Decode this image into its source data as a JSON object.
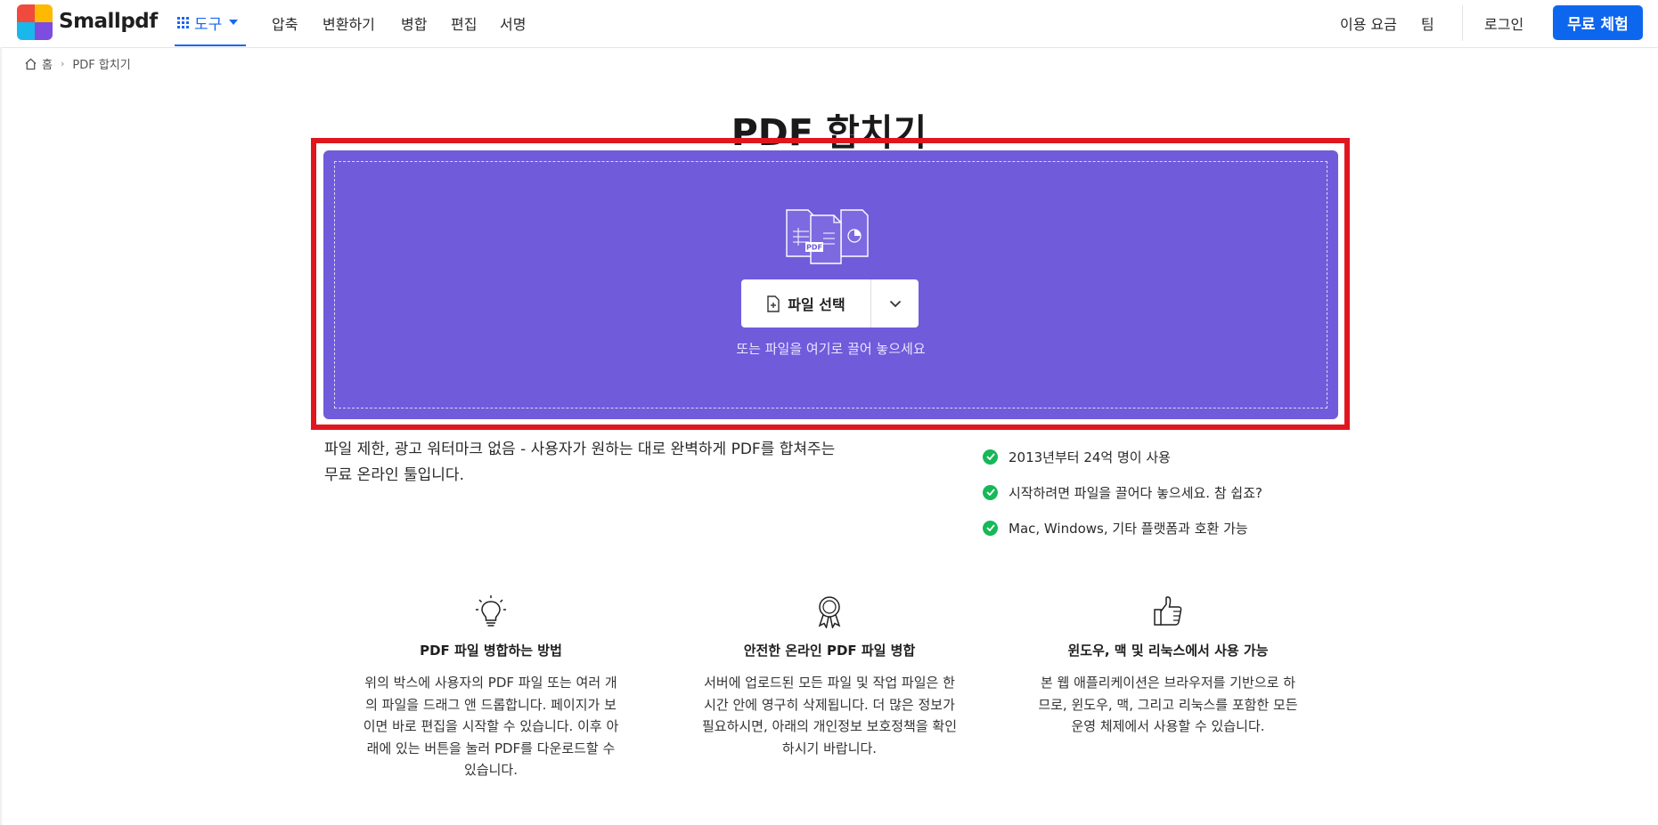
{
  "header": {
    "brand": "Smallpdf",
    "logo_colors": [
      "#f04a3e",
      "#ffb900",
      "#1ab7ea",
      "#22c55e"
    ],
    "tools_label": "도구",
    "nav": [
      "압축",
      "변환하기",
      "병합",
      "편집",
      "서명"
    ],
    "pricing_label": "이용 요금",
    "team_label": "팀",
    "login_label": "로그인",
    "cta_label": "무료 체험"
  },
  "breadcrumb": {
    "home": "홈",
    "current": "PDF 합치기"
  },
  "page_title": "PDF 합치기",
  "dropzone": {
    "bg_color": "#705bdb",
    "file_badge": "PDF",
    "choose_label": "파일 선택",
    "hint": "또는 파일을 여기로 끌어 놓으세요"
  },
  "description": {
    "line1": "파일 제한, 광고 워터마크 없음 - 사용자가 원하는 대로 완벽하게 PDF를 합쳐주는",
    "line2": "무료 온라인 툴입니다."
  },
  "checks": [
    "2013년부터 24억 명이 사용",
    "시작하려면 파일을 끌어다 놓으세요. 참 쉽죠?",
    "Mac, Windows, 기타 플랫폼과 호환 가능"
  ],
  "features": [
    {
      "icon": "lightbulb-icon",
      "title": "PDF 파일 병합하는 방법",
      "text": "위의 박스에 사용자의 PDF 파일 또는 여러 개의 파일을 드래그 앤 드롭합니다. 페이지가 보이면 바로 편집을 시작할 수 있습니다. 이후 아래에 있는 버튼을 눌러 PDF를 다운로드할 수 있습니다."
    },
    {
      "icon": "award-ribbon-icon",
      "title": "안전한 온라인 PDF 파일 병합",
      "text": "서버에 업로드된 모든 파일 및 작업 파일은 한 시간 안에 영구히 삭제됩니다. 더 많은 정보가 필요하시면, 아래의 개인정보 보호정책을 확인하시기 바랍니다."
    },
    {
      "icon": "thumbs-up-icon",
      "title": "윈도우, 맥 및 리눅스에서 사용 가능",
      "text": "본 웹 애플리케이션은 브라우저를 기반으로 하므로, 윈도우, 맥, 그리고 리눅스를 포함한 모든 운영 체제에서 사용할 수 있습니다."
    }
  ]
}
